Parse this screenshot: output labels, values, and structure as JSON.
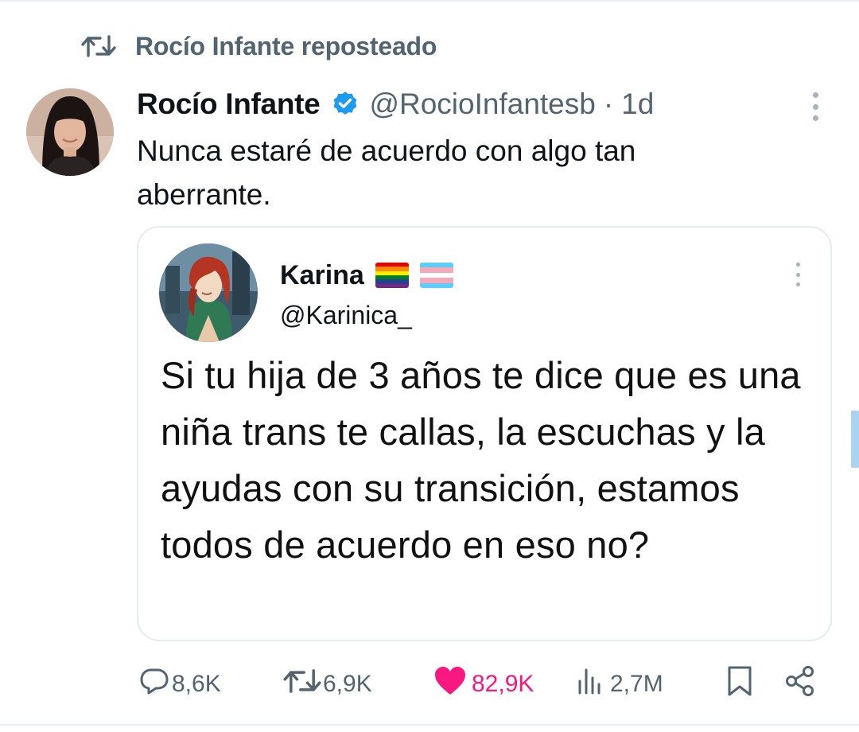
{
  "repost": {
    "label": "Rocío Infante reposteado"
  },
  "tweet": {
    "author_name": "Rocío Infante",
    "author_handle": "@RocioInfantesb",
    "separator": "·",
    "time": "1d",
    "text": "Nunca estaré de acuerdo con algo tan aberrante."
  },
  "quote": {
    "author_name": "Karina",
    "author_handle": "@Karinica_",
    "flags": [
      "rainbow-flag",
      "transgender-flag"
    ],
    "text": "Si tu hija de 3 años te dice que es una niña trans te callas, la escuchas y la ayudas con su transición, estamos todos de acuerdo en eso no?"
  },
  "actions": {
    "replies": "8,6K",
    "reposts": "6,9K",
    "likes": "82,9K",
    "views": "2,7M"
  },
  "colors": {
    "text_primary": "#0f1419",
    "text_secondary": "#536471",
    "verified": "#1d9bf0",
    "like": "#f91880",
    "border": "#e6ebee"
  },
  "icons": [
    "repost-icon",
    "verified-badge-icon",
    "more-icon",
    "reply-icon",
    "like-icon",
    "views-icon",
    "bookmark-icon",
    "share-icon"
  ]
}
